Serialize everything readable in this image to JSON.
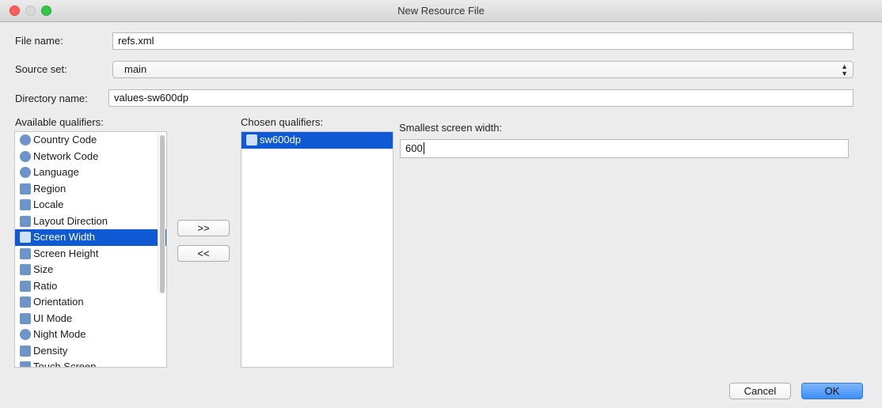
{
  "window": {
    "title": "New Resource File"
  },
  "form": {
    "file_name_label": "File name:",
    "file_name_value": "refs.xml",
    "source_set_label": "Source set:",
    "source_set_value": "main",
    "directory_name_label": "Directory name:",
    "directory_name_value": "values-sw600dp"
  },
  "available": {
    "label": "Available qualifiers:",
    "items": [
      {
        "label": "Country Code",
        "icon": "country-code-icon"
      },
      {
        "label": "Network Code",
        "icon": "network-code-icon"
      },
      {
        "label": "Language",
        "icon": "language-icon"
      },
      {
        "label": "Region",
        "icon": "region-icon"
      },
      {
        "label": "Locale",
        "icon": "locale-icon"
      },
      {
        "label": "Layout Direction",
        "icon": "layout-direction-icon"
      },
      {
        "label": "Screen Width",
        "icon": "screen-width-icon",
        "selected": true
      },
      {
        "label": "Screen Height",
        "icon": "screen-height-icon"
      },
      {
        "label": "Size",
        "icon": "size-icon"
      },
      {
        "label": "Ratio",
        "icon": "ratio-icon"
      },
      {
        "label": "Orientation",
        "icon": "orientation-icon"
      },
      {
        "label": "UI Mode",
        "icon": "ui-mode-icon"
      },
      {
        "label": "Night Mode",
        "icon": "night-mode-icon"
      },
      {
        "label": "Density",
        "icon": "density-icon"
      },
      {
        "label": "Touch Screen",
        "icon": "touch-screen-icon"
      }
    ]
  },
  "transfer": {
    "add_label": ">>",
    "remove_label": "<<"
  },
  "chosen": {
    "label": "Chosen qualifiers:",
    "items": [
      {
        "label": "sw600dp",
        "icon": "screen-width-icon",
        "selected": true
      }
    ]
  },
  "detail": {
    "label": "Smallest screen width:",
    "value": "600"
  },
  "footer": {
    "cancel_label": "Cancel",
    "ok_label": "OK"
  },
  "colors": {
    "selection": "#0f5ad4",
    "ok_button": "#3d8ef7"
  }
}
